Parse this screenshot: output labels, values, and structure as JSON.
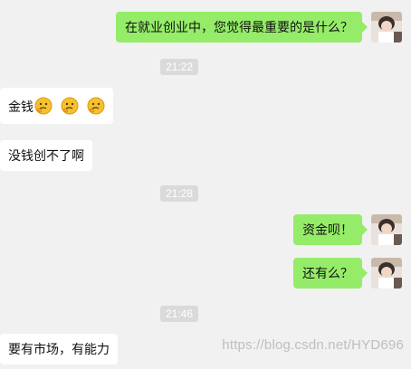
{
  "messages": [
    {
      "side": "right",
      "text": "在就业创业中，您觉得最重要的是什么？"
    },
    {
      "type": "time",
      "text": "21:22"
    },
    {
      "side": "left",
      "text": "金钱",
      "emojis": [
        "thinking-face",
        "thinking-face",
        "thinking-face"
      ]
    },
    {
      "side": "left",
      "text": "没钱创不了啊"
    },
    {
      "type": "time",
      "text": "21:28"
    },
    {
      "side": "right",
      "text": "资金呗！"
    },
    {
      "side": "right",
      "text": "还有么？"
    },
    {
      "type": "time",
      "text": "21:46"
    },
    {
      "side": "left",
      "text": "要有市场，有能力"
    }
  ],
  "watermark": "https://blog.csdn.net/HYD696",
  "colors": {
    "background": "#f1f1f1",
    "sent_bubble": "#95ec69",
    "received_bubble": "#ffffff",
    "timestamp_bg": "#dadada"
  }
}
